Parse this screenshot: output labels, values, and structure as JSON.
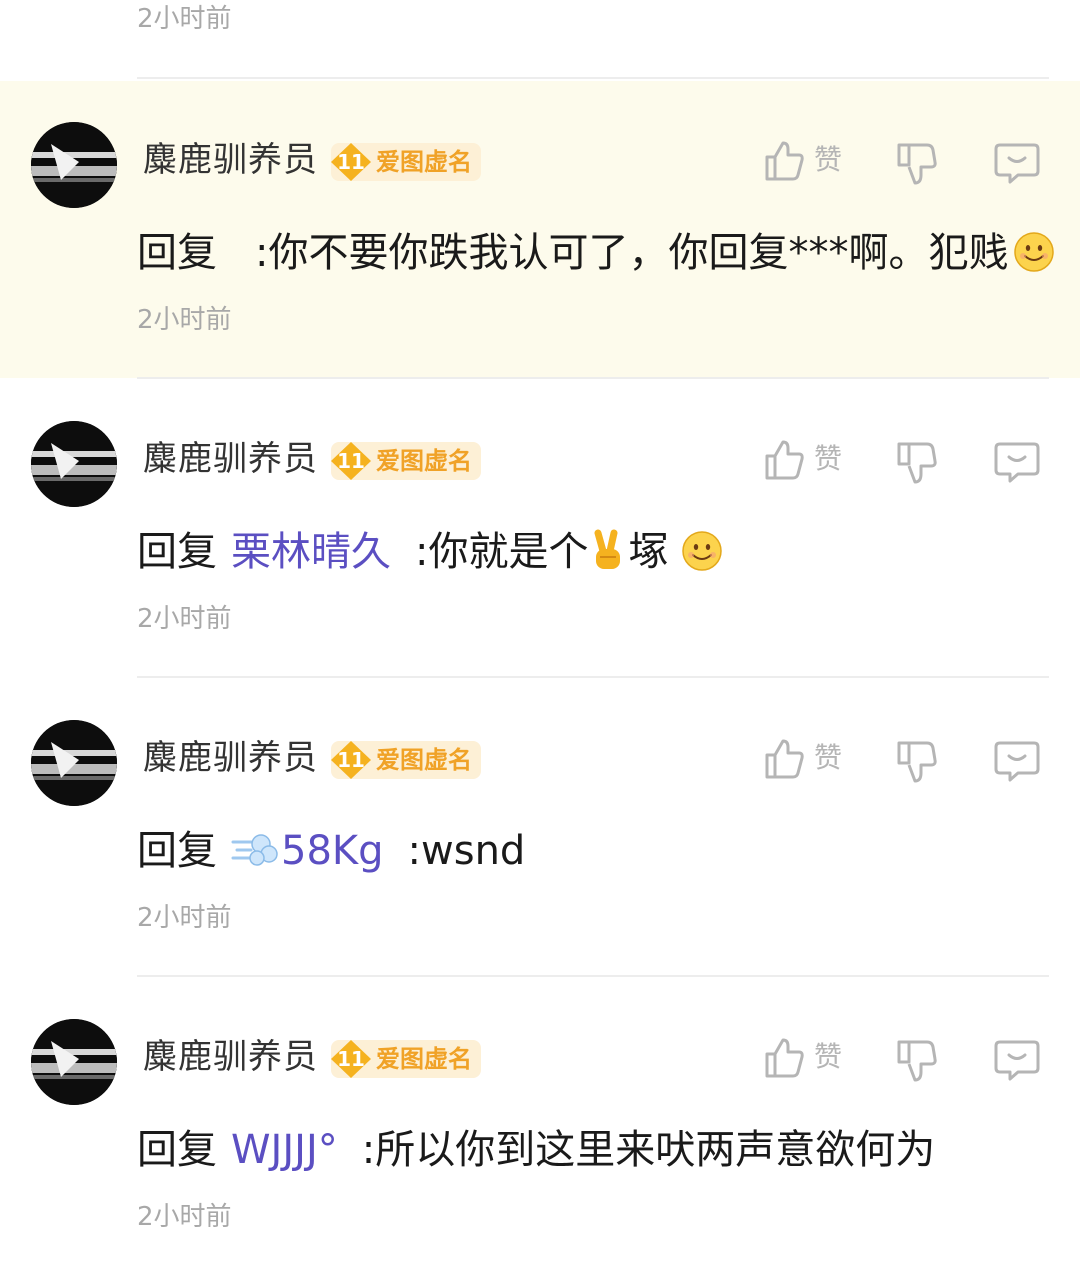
{
  "top_time": "2小时前",
  "comments": [
    {
      "username": "麋鹿驯养员",
      "badge_level": "11",
      "badge_text": "爱图虚名",
      "like_label": "赞",
      "reply_word": "回复",
      "mention": "",
      "text": ":你不要你跌我认可了，你回复***啊。犯贱",
      "emoji": "smile-emoji",
      "time": "2小时前"
    },
    {
      "username": "麋鹿驯养员",
      "badge_level": "11",
      "badge_text": "爱图虚名",
      "like_label": "赞",
      "reply_word": "回复",
      "mention": "栗林晴久",
      "text_before": ":你就是个",
      "text_after": "塚",
      "emoji": "smile-emoji",
      "inline_emoji": "victory-hand-emoji",
      "time": "2小时前"
    },
    {
      "username": "麋鹿驯养员",
      "badge_level": "11",
      "badge_text": "爱图虚名",
      "like_label": "赞",
      "reply_word": "回复",
      "mention": "58Kg",
      "mention_emoji": "dash-emoji",
      "text": ":wsnd",
      "time": "2小时前"
    },
    {
      "username": "麋鹿驯养员",
      "badge_level": "11",
      "badge_text": "爱图虚名",
      "like_label": "赞",
      "reply_word": "回复",
      "mention": "WJJJJ°",
      "text": ":所以你到这里来吠两声意欲何为",
      "time": "2小时前"
    }
  ],
  "colors": {
    "highlight_bg": "#fdfbec",
    "mention": "#5b4fc2",
    "badge_bg": "#fdf0d6",
    "badge_text": "#f0a227",
    "meta_gray": "#a8a8a8"
  }
}
